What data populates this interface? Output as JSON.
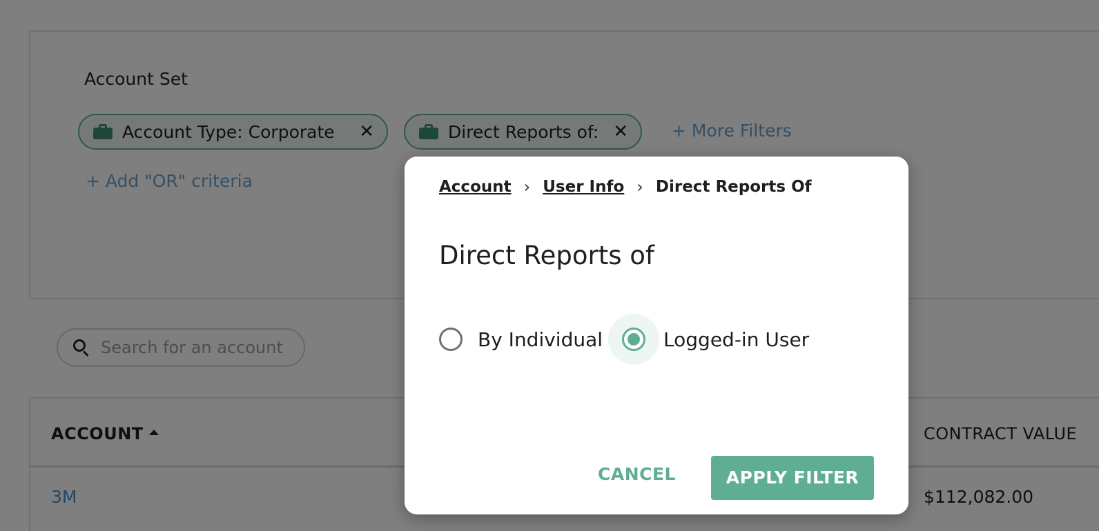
{
  "filter_panel": {
    "label": "Account Set",
    "chips": [
      {
        "icon": "briefcase-icon",
        "label": "Account Type: Corporate"
      },
      {
        "icon": "briefcase-icon",
        "label": "Direct Reports of:"
      }
    ],
    "more_filters": "+ More Filters",
    "add_or_criteria": "+ Add \"OR\" criteria"
  },
  "search": {
    "placeholder": "Search for an account",
    "icon": "search-icon"
  },
  "table": {
    "headers": {
      "account": "ACCOUNT",
      "contract_value": "CONTRACT VALUE"
    },
    "rows": [
      {
        "account": "3M",
        "contract_value": "$112,082.00"
      }
    ]
  },
  "modal": {
    "breadcrumb": [
      "Account",
      "User Info",
      "Direct Reports Of"
    ],
    "title": "Direct Reports of",
    "radio_options": [
      {
        "label": "By Individual",
        "checked": false
      },
      {
        "label": "Logged-in User",
        "checked": true
      }
    ],
    "cancel_label": "CANCEL",
    "apply_label": "APPLY FILTER"
  },
  "colors": {
    "accent": "#5fae91",
    "link": "#4a90c8",
    "overlay": "rgba(0,0,0,0.5)"
  }
}
